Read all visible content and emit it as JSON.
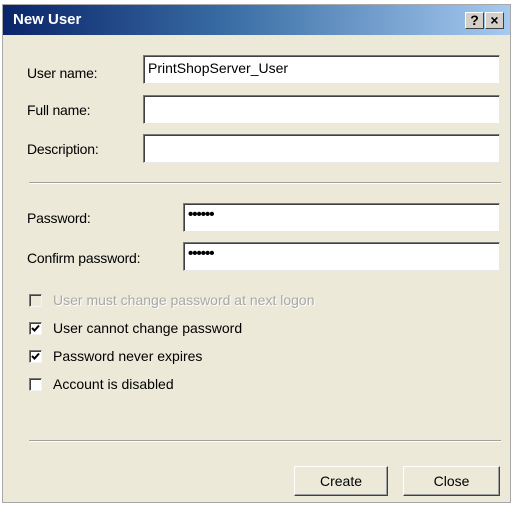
{
  "window": {
    "title": "New User",
    "help_label": "?",
    "close_glyph": "×"
  },
  "form": {
    "username_label": "User name:",
    "username_value": "PrintShopServer_User",
    "fullname_label": "Full name:",
    "fullname_value": "",
    "description_label": "Description:",
    "description_value": "",
    "password_label": "Password:",
    "password_value": "••••••",
    "confirm_label": "Confirm password:",
    "confirm_value": "••••••"
  },
  "options": [
    {
      "label": "User must change password at next logon",
      "checked": false,
      "enabled": false
    },
    {
      "label": "User cannot change password",
      "checked": true,
      "enabled": true
    },
    {
      "label": "Password never expires",
      "checked": true,
      "enabled": true
    },
    {
      "label": "Account is disabled",
      "checked": false,
      "enabled": true
    }
  ],
  "buttons": {
    "create_label": "Create",
    "close_label": "Close"
  },
  "colors": {
    "title_bar_start": "#0a246a",
    "title_bar_end": "#a6caf0",
    "dialog_bg": "#ece9d8"
  }
}
